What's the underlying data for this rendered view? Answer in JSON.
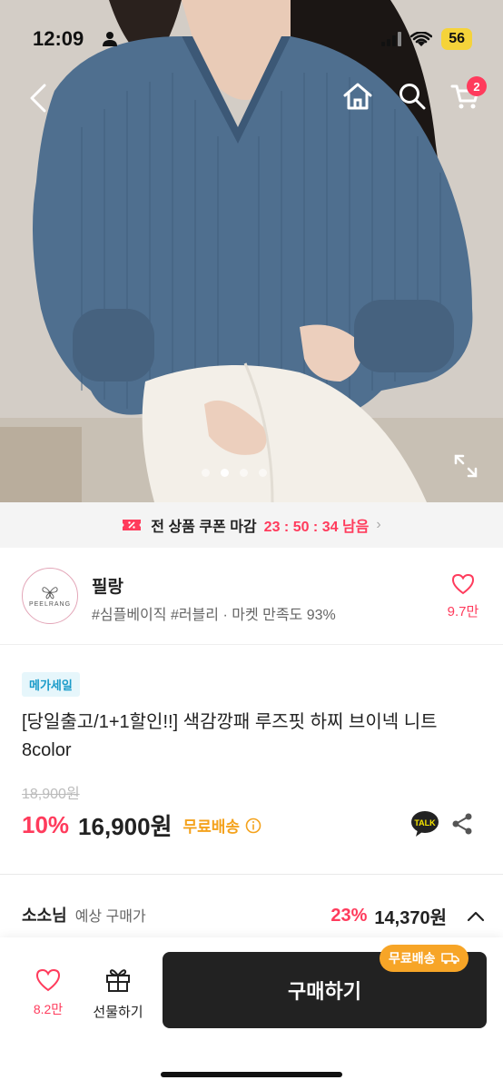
{
  "status": {
    "time": "12:09",
    "battery": "56"
  },
  "nav": {
    "cart_count": "2"
  },
  "hero": {
    "image_desc": "sweater-model-photo",
    "page_count": 4,
    "active_page": 1
  },
  "coupon": {
    "label": "전 상품 쿠폰 마감",
    "timer": "23 : 50 : 34 남음"
  },
  "shop": {
    "name": "필랑",
    "logo_text": "PEELRANG",
    "tags": "#심플베이직 #러블리 · 마켓 만족도 93%",
    "like_count": "9.7만"
  },
  "product": {
    "badge": "메가세일",
    "title": "[당일출고/1+1할인!!] 색감깡패 루즈핏 하찌 브이넥 니트 8color",
    "original_price": "18,900원",
    "discount": "10%",
    "price": "16,900원",
    "free_shipping": "무료배송",
    "talk_label": "TALK"
  },
  "expected": {
    "user": "소소님",
    "label": "예상 구매가",
    "discount": "23%",
    "price": "14,370원"
  },
  "bottom": {
    "like_count": "8.2만",
    "gift_label": "선물하기",
    "buy_label": "구매하기",
    "ship_pill": "무료배송"
  },
  "colors": {
    "accent": "#ff3b5c",
    "ship": "#f7a527",
    "buy_bg": "#222222",
    "badge_text": "#1a9bc9"
  }
}
